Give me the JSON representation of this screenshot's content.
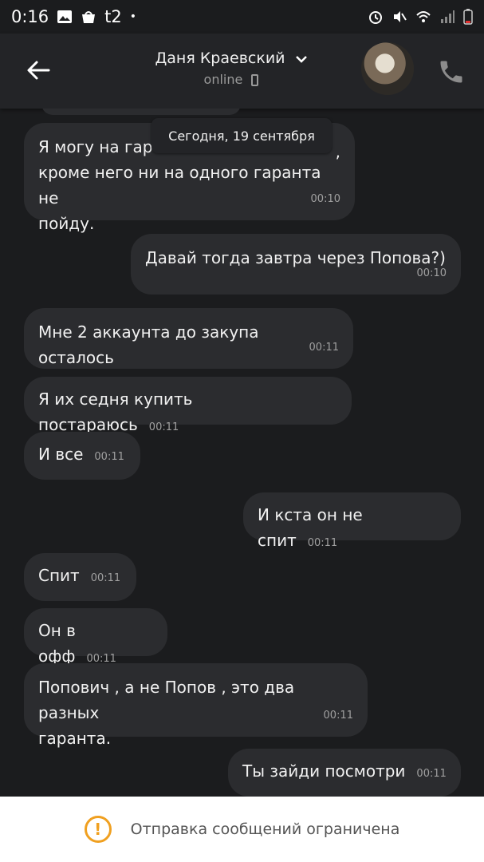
{
  "status_bar": {
    "time": "0:16",
    "carrier": "t2",
    "icons": [
      "image-icon",
      "bag-icon",
      "alarm-icon",
      "mute-icon",
      "wifi-icon",
      "signal-icon",
      "battery-icon"
    ]
  },
  "header": {
    "contact_name": "Даня Краевский",
    "status": "online",
    "icons": [
      "back-arrow-icon",
      "chevron-down-icon",
      "phone-device-icon",
      "call-icon"
    ]
  },
  "date_chip": "Сегодня, 19 сентября",
  "messages": [
    {
      "text": "Я могу на гар",
      "text2": "кроме него ни на одного гаранта не",
      "text3": "пойду.",
      "time": "00:10",
      "side": "incoming"
    },
    {
      "text": "Давай тогда завтра через Попова?)",
      "time": "00:10",
      "side": "outgoing"
    },
    {
      "text": "Мне 2 аккаунта до закупа осталось",
      "time": "00:11",
      "side": "incoming"
    },
    {
      "text": "Я их седня купить постараюсь",
      "time": "00:11",
      "side": "incoming"
    },
    {
      "text": "И все",
      "time": "00:11",
      "side": "incoming"
    },
    {
      "text": "И кста он не спит",
      "time": "00:11",
      "side": "outgoing"
    },
    {
      "text": "Спит",
      "time": "00:11",
      "side": "incoming"
    },
    {
      "text": "Он в офф",
      "time": "00:11",
      "side": "incoming"
    },
    {
      "text": "Попович , а не Попов , это два разных",
      "text2": "гаранта.",
      "time": "00:11",
      "side": "incoming"
    },
    {
      "text": "Ты зайди посмотри",
      "time": "00:11",
      "side": "outgoing"
    }
  ],
  "footer": {
    "notice": "Отправка сообщений ограничена",
    "icon": "warning-icon"
  },
  "colors": {
    "background": "#1b1c1e",
    "bubble": "#2b2c2f",
    "header": "#232427",
    "warning": "#f0a020"
  }
}
